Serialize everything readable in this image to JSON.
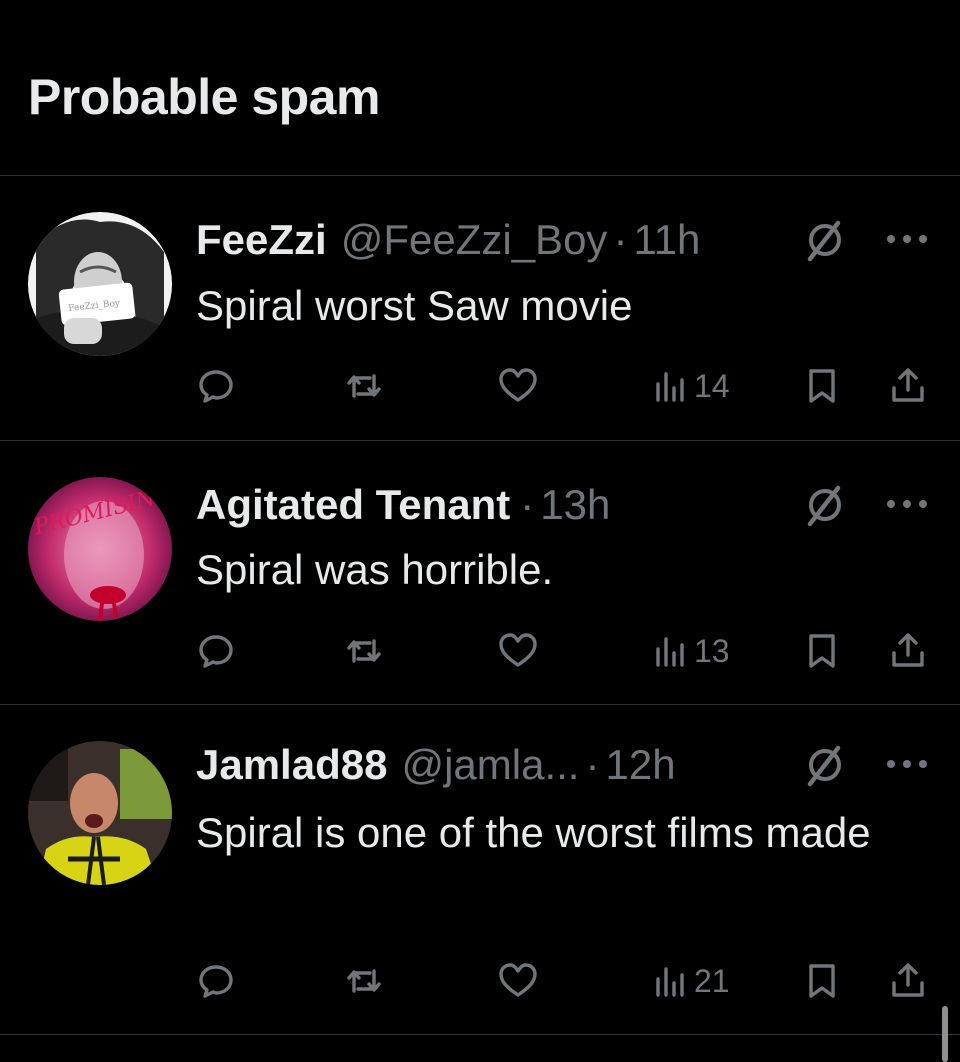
{
  "header": {
    "title": "Probable spam"
  },
  "posts": [
    {
      "name": "FeeZzi",
      "handle": "@FeeZzi_Boy",
      "time": "11h",
      "text": "Spiral worst Saw movie",
      "views": "14",
      "avatar_text": "FeeZzi_Boy"
    },
    {
      "name": "Agitated Tenant",
      "handle": "",
      "time": "13h",
      "text": "Spiral was horrible.",
      "views": "13",
      "avatar_text": "PROMISING YOUNG WOMAN"
    },
    {
      "name": "Jamlad88",
      "handle": "@jamla...",
      "time": "12h",
      "text": "Spiral is one of the worst films made",
      "views": "21"
    }
  ],
  "icons": {
    "reply": "reply-icon",
    "repost": "repost-icon",
    "like": "heart-icon",
    "views": "views-chart-icon",
    "bookmark": "bookmark-icon",
    "share": "share-icon",
    "grok": "grok-icon",
    "more": "more-dots-icon"
  },
  "colors": {
    "background": "#000000",
    "text": "#e7e9ea",
    "muted": "#71767b",
    "divider": "#2f3336"
  }
}
